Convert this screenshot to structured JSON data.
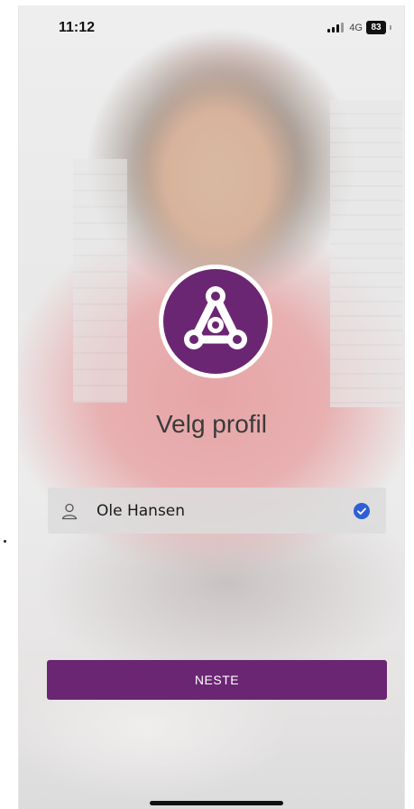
{
  "status_bar": {
    "time": "11:12",
    "network": "4G",
    "battery": "83"
  },
  "main": {
    "title": "Velg profil",
    "profiles": [
      {
        "name": "Ole Hansen",
        "selected": true
      }
    ],
    "next_label": "NESTE"
  },
  "colors": {
    "brand": "#6b2673",
    "check": "#2f5fd6"
  },
  "icons": {
    "logo": "app-logo-icon",
    "person": "person-icon",
    "check": "check-circle-icon"
  }
}
